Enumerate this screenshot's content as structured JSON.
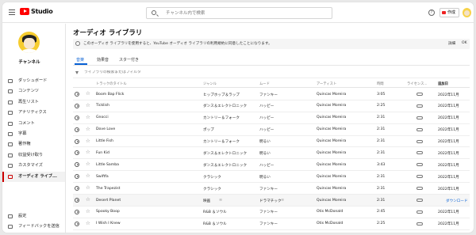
{
  "header": {
    "brand": "Studio",
    "search_placeholder": "チャンネル内で検索",
    "help": "?",
    "create_label": "作成"
  },
  "sidebar": {
    "channel_name": "チャンネル",
    "items": [
      {
        "label": "ダッシュボード"
      },
      {
        "label": "コンテンツ"
      },
      {
        "label": "再生リスト"
      },
      {
        "label": "アナリティクス"
      },
      {
        "label": "コメント"
      },
      {
        "label": "字幕"
      },
      {
        "label": "著作権"
      },
      {
        "label": "収益受け取り"
      },
      {
        "label": "カスタマイズ"
      },
      {
        "label": "オーディオ ライブ..."
      }
    ],
    "active_index": 9,
    "bottom_items": [
      {
        "label": "設定"
      },
      {
        "label": "フィードバックを送信"
      }
    ]
  },
  "main": {
    "title": "オーディオ ライブラリ",
    "banner": {
      "text": "このオーディオ ライブラリを使用すると、YouTube オーディオ ライブラリの利用規約に同意したことになります。",
      "link": "詳細",
      "ok": "OK"
    },
    "tabs": [
      {
        "label": "音楽"
      },
      {
        "label": "効果音"
      },
      {
        "label": "スター付き"
      }
    ],
    "filter_placeholder": "ライブラリの検索またはフィルタ",
    "columns": {
      "track": "トラックのタイトル",
      "genre": "ジャンル",
      "mood": "ムード",
      "artist": "アーティスト",
      "duration": "時間",
      "license": "ライセンス...",
      "added": "追加日"
    },
    "download_label": "ダウンロード",
    "tracks": [
      {
        "title": "Boom Bap Flick",
        "genre": "ヒップホップ＆ラップ",
        "mood": "ファンキー",
        "artist": "Quincas Moreira",
        "duration": "3:05",
        "added": "2022年11月"
      },
      {
        "title": "Ticklish",
        "genre": "ダンス＆エレクトロニック",
        "mood": "ハッピー",
        "artist": "Quincas Moreira",
        "duration": "2:25",
        "added": "2022年11月"
      },
      {
        "title": "Gnocci",
        "genre": "カントリー＆フォーク",
        "mood": "ハッピー",
        "artist": "Quincas Moreira",
        "duration": "2:31",
        "added": "2022年11月"
      },
      {
        "title": "Dove Love",
        "genre": "ポップ",
        "mood": "ハッピー",
        "artist": "Quincas Moreira",
        "duration": "2:31",
        "added": "2022年11月"
      },
      {
        "title": "Little Fish",
        "genre": "カントリー＆フォーク",
        "mood": "明るい",
        "artist": "Quincas Moreira",
        "duration": "2:31",
        "added": "2022年11月"
      },
      {
        "title": "Fun Kid",
        "genre": "ダンス＆エレクトロニック",
        "mood": "明るい",
        "artist": "Quincas Moreira",
        "duration": "2:31",
        "added": "2022年11月"
      },
      {
        "title": "Little Samba",
        "genre": "ダンス＆エレクトロニック",
        "mood": "ハッピー",
        "artist": "Quincas Moreira",
        "duration": "3:43",
        "added": "2022年11月"
      },
      {
        "title": "Swiftfa",
        "genre": "クラシック",
        "mood": "明るい",
        "artist": "Quincas Moreira",
        "duration": "2:31",
        "added": "2022年11月"
      },
      {
        "title": "The Trapezist",
        "genre": "クラシック",
        "mood": "ファンキー",
        "artist": "Quincas Moreira",
        "duration": "2:31",
        "added": "2022年11月"
      },
      {
        "title": "Desert Planet",
        "genre": "映画",
        "mood": "ドラマチック",
        "artist": "Quincas Moreira",
        "duration": "2:31",
        "added": ""
      },
      {
        "title": "Spooky Boop",
        "genre": "R&B ＆ソウル",
        "mood": "ファンキー",
        "artist": "Otis McDonald",
        "duration": "2:45",
        "added": "2022年11月"
      },
      {
        "title": "I Wish I Knew",
        "genre": "R&B ＆ソウル",
        "mood": "ファンキー",
        "artist": "Otis McDonald",
        "duration": "2:25",
        "added": "2022年11月"
      }
    ],
    "hover_row_index": 9
  }
}
